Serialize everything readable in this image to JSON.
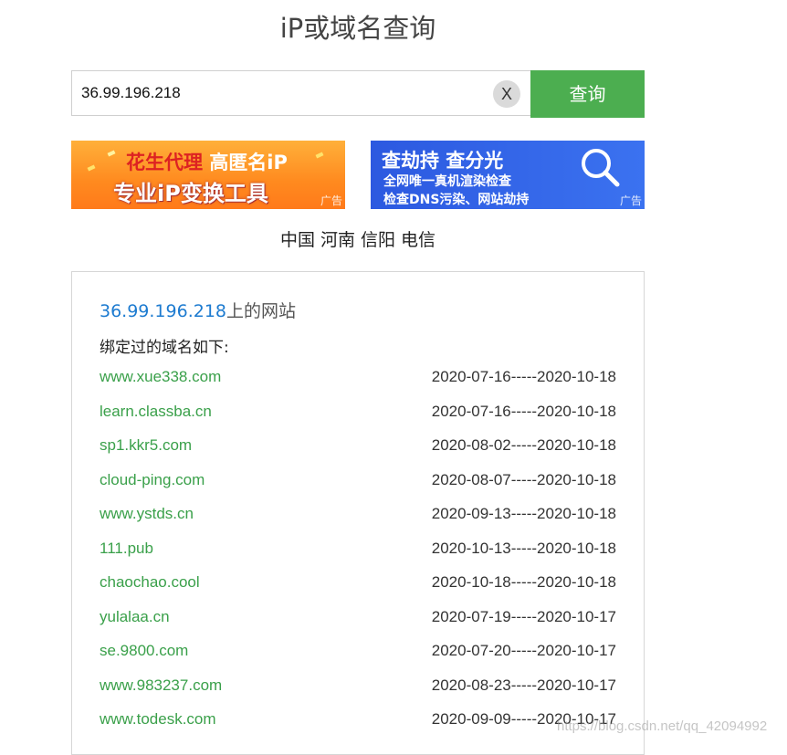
{
  "header": {
    "title": "iP或域名查询"
  },
  "search": {
    "value": "36.99.196.218",
    "clear_label": "X",
    "submit_label": "查询"
  },
  "ads": [
    {
      "line1_a": "花生代理",
      "line1_b": "高匿名iP",
      "line2": "专业iP变换工具",
      "tag": "广告"
    },
    {
      "line1": "查劫持 查分光",
      "line2": "全网唯一真机渲染检查",
      "line3": "检查DNS污染、网站劫持",
      "tag": "广告"
    }
  ],
  "location": "中国 河南 信阳 电信",
  "result": {
    "ip": "36.99.196.218",
    "title_suffix": "上的网站",
    "subtitle": "绑定过的域名如下:",
    "rows": [
      {
        "domain": "www.xue338.com",
        "dates": "2020-07-16-----2020-10-18"
      },
      {
        "domain": "learn.classba.cn",
        "dates": "2020-07-16-----2020-10-18"
      },
      {
        "domain": "sp1.kkr5.com",
        "dates": "2020-08-02-----2020-10-18"
      },
      {
        "domain": "cloud-ping.com",
        "dates": "2020-08-07-----2020-10-18"
      },
      {
        "domain": "www.ystds.cn",
        "dates": "2020-09-13-----2020-10-18"
      },
      {
        "domain": "111.pub",
        "dates": "2020-10-13-----2020-10-18"
      },
      {
        "domain": "chaochao.cool",
        "dates": "2020-10-18-----2020-10-18"
      },
      {
        "domain": "yulalaa.cn",
        "dates": "2020-07-19-----2020-10-17"
      },
      {
        "domain": "se.9800.com",
        "dates": "2020-07-20-----2020-10-17"
      },
      {
        "domain": "www.983237.com",
        "dates": "2020-08-23-----2020-10-17"
      },
      {
        "domain": "www.todesk.com",
        "dates": "2020-09-09-----2020-10-17"
      }
    ]
  },
  "watermark": "https://blog.csdn.net/qq_42094992",
  "colors": {
    "accent_green": "#4cae50",
    "link_green": "#3aa04a",
    "ip_blue": "#1d7bd0"
  }
}
